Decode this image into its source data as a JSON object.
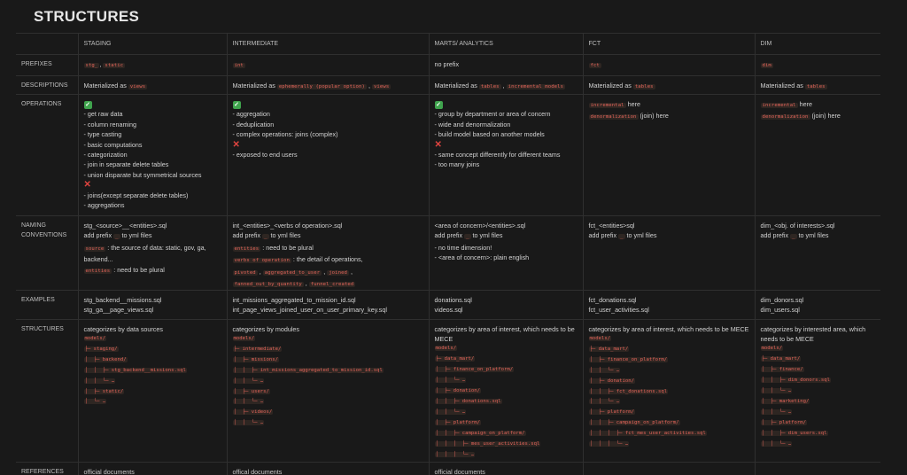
{
  "title": "STRUCTURES",
  "columns": [
    "",
    "STAGING",
    "INTERMEDIATE",
    "MARTS/ ANALYTICS",
    "FCT",
    "DIM"
  ],
  "rows": {
    "prefixes": {
      "label": "PREFIXES",
      "staging": {
        "code1": "stg_",
        "sep": ", ",
        "code2": "static"
      },
      "intermediate": {
        "code1": "int"
      },
      "marts": {
        "text": "no prefix"
      },
      "fct": {
        "code1": "fct"
      },
      "dim": {
        "code1": "dim"
      }
    },
    "descriptions": {
      "label": "DESCRIPTIONS",
      "staging": {
        "pre": "Materialized as ",
        "code1": "views"
      },
      "intermediate": {
        "pre": "Materialized as ",
        "code1": "ephemerally (popular option)",
        "sep": " , ",
        "code2": "views"
      },
      "marts": {
        "pre": "Materialized as ",
        "code1": "tables",
        "sep": " , ",
        "code2": "incremental models"
      },
      "fct": {
        "pre": "Materialized as ",
        "code1": "tables"
      },
      "dim": {
        "pre": "Materialized as ",
        "code1": "tables"
      }
    },
    "operations": {
      "label": "OPERATIONS",
      "check_glyph": "✓",
      "cross_glyph": "✕",
      "staging": {
        "yes": [
          "- get raw data",
          "- column renaming",
          "- type casting",
          "- basic computations",
          "- categorization",
          "- join in separate delete tables",
          "- union disparate but symmetrical sources"
        ],
        "no": [
          "- joins(except separate delete tables)",
          "- aggregations"
        ]
      },
      "intermediate": {
        "yes": [
          "- aggregation",
          "- deduplication",
          "- complex operations: joins (complex)"
        ],
        "no": [
          "- exposed to end users"
        ]
      },
      "marts": {
        "yes": [
          "- group by department or area of concern",
          "- wide and denormalization",
          "- build model based on another models"
        ],
        "no": [
          "- same concept differently for different teams",
          "- too many joins"
        ]
      },
      "fct": {
        "line1_code": "incremental",
        "line1_text": " here",
        "line2_code": "denormalization",
        "line2_text": " (join) here"
      },
      "dim": {
        "line1_code": "incremental",
        "line1_text": " here",
        "line2_code": "denormalization",
        "line2_text": " (join) here"
      }
    },
    "naming": {
      "label1": "NAMING",
      "label2": "CONVENTIONS",
      "staging": {
        "l1": "stg_<source>__<entities>.sql",
        "l2_pre": "add prefix ",
        "l2_code": "_",
        "l2_post": " to yml files",
        "l3_code": "source",
        "l3_post": " : the source of data: static, gov, ga, backend...",
        "l4_code": "entities",
        "l4_post": " : need to be plural"
      },
      "intermediate": {
        "l1": "int_<entities>_<verbs of operation>.sql",
        "l2_pre": "add prefix ",
        "l2_code": "_",
        "l2_post": " to yml files",
        "l3_code": "entities",
        "l3_post": " : need to be plural",
        "l4_code": "verbs of operation",
        "l4_post": " : the detail of operations,",
        "l5_codes": [
          "pivoted",
          "aggregated_to_user",
          "joined",
          "fanned_out_by_quantity",
          "funnel_created"
        ]
      },
      "marts": {
        "l1": "<area of concern>/<entities>.sql",
        "l2_pre": "add prefix ",
        "l2_code": "_",
        "l2_post": " to yml files",
        "l3": "- no time dimension!",
        "l4": "- <area of concern>: plain english"
      },
      "fct": {
        "l1": "fct_<entities>sql",
        "l2_pre": "add prefix ",
        "l2_code": "_",
        "l2_post": " to yml files"
      },
      "dim": {
        "l1": "dim_<obj. of interests>.sql",
        "l2_pre": "add prefix ",
        "l2_code": "_",
        "l2_post": " to yml files"
      }
    },
    "examples": {
      "label": "EXAMPLES",
      "staging": [
        "stg_backend__missions.sql",
        "stg_ga__page_views.sql"
      ],
      "intermediate": [
        "int_missions_aggregated_to_mission_id.sql",
        "int_page_views_joined_user_on_user_primary_key.sql"
      ],
      "marts": [
        "donations.sql",
        "videos.sql"
      ],
      "fct": [
        "fct_donations.sql",
        "fct_user_activities.sql"
      ],
      "dim": [
        "dim_donors.sql",
        "dim_users.sql"
      ]
    },
    "structures": {
      "label": "STRUCTURES",
      "staging": {
        "desc": "categorizes by data sources",
        "tree": [
          "models/",
          "├─ staging/",
          "│  ├─ backend/",
          "│  │  ├─ stg_backend__missions.sql",
          "│  │  └─ …",
          "│  ├─ static/",
          "│  └─ …"
        ]
      },
      "intermediate": {
        "desc": "categorizes by modules",
        "tree": [
          "models/",
          "├─ intermediate/",
          "│  ├─ missions/",
          "│  │  ├─ int_missions_aggregated_to_mission_id.sql",
          "│  │  └─ …",
          "│  ├─ users/",
          "│  │  └─ …",
          "│  ├─ videos/",
          "│  │  └─ …"
        ]
      },
      "marts": {
        "desc": "categorizes by area of interest, which needs to be MECE",
        "tree": [
          "models/",
          "├─ data_mart/",
          "│  ├─ finance_on_platform/",
          "│  │  └─ …",
          "│  ├─ donation/",
          "│  │  ├─ donations.sql",
          "│  │  └─ …",
          "│  ├─ platform/",
          "│  │  ├─ campaign_on_platform/",
          "│  │  │  ├─ mes_user_activities.sql",
          "│  │  │  └─ …"
        ]
      },
      "fct": {
        "desc": "categorizes by area of interest, which needs to be MECE",
        "tree": [
          "models/",
          "├─ data_mart/",
          "│  ├─ finance_on_platform/",
          "│  │  └─ …",
          "│  ├─ donation/",
          "│  │  ├─ fct_donations.sql",
          "│  │  └─ …",
          "│  ├─ platform/",
          "│  │  ├─ campaign_on_platform/",
          "│  │  │  ├─ fct_mes_user_activities.sql",
          "│  │  │  └─ …"
        ]
      },
      "dim": {
        "desc": "categorizes by interested area, which needs to be MECE",
        "tree": [
          "models/",
          "├─ data_mart/",
          "│  ├─ finance/",
          "│  │  ├─ dim_donors.sql",
          "│  │  └─ …",
          "│  ├─ marketing/",
          "│  │  └─ …",
          "│  ├─ platform/",
          "│  │  ├─ dim_users.sql",
          "│  │  └─ …"
        ]
      }
    },
    "references": {
      "label": "REFERENCES",
      "staging": "official documents",
      "intermediate": "offical documents",
      "marts": "official documents",
      "fct": "",
      "dim": ""
    }
  }
}
